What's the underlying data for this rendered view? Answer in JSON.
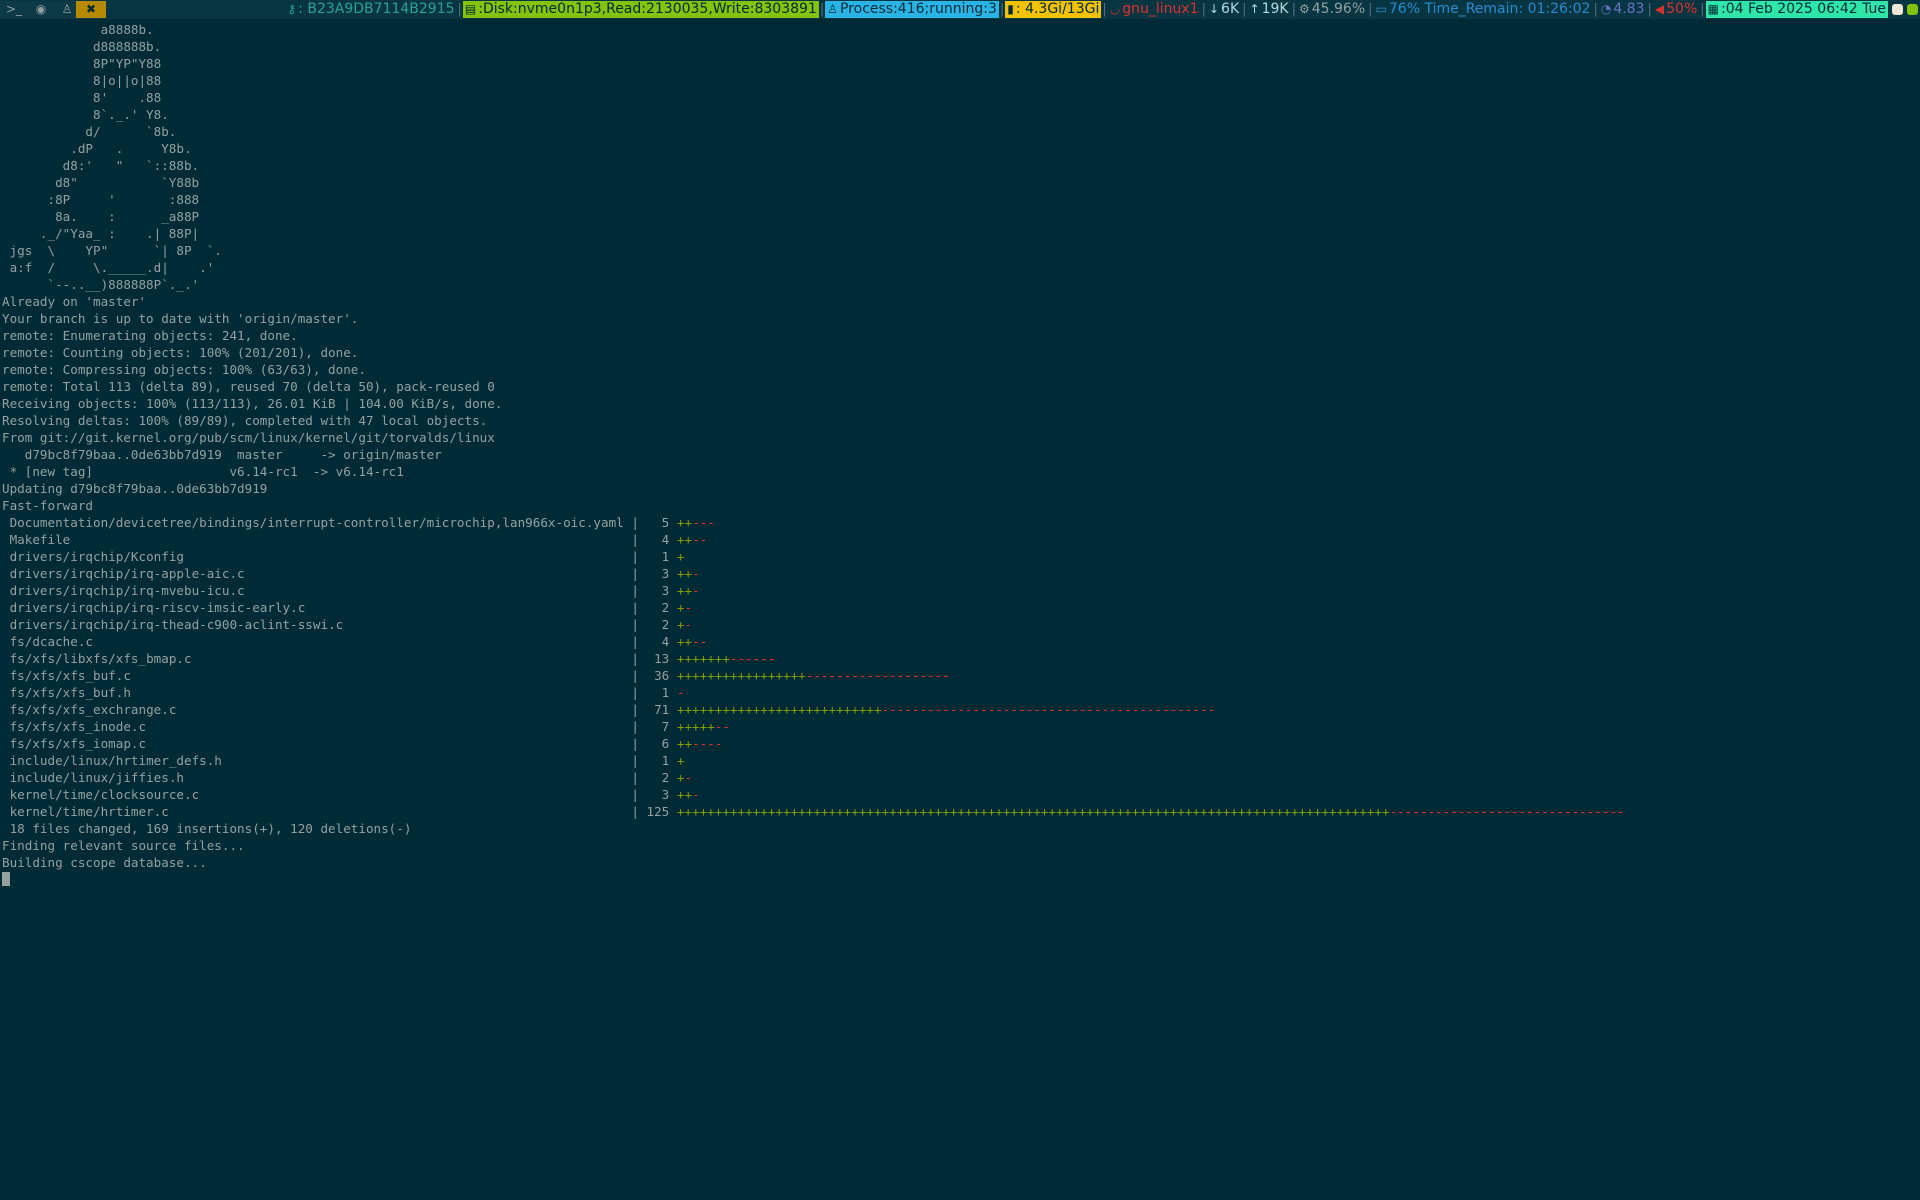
{
  "topbar": {
    "workspaces": [
      {
        "icon": "terminal-icon",
        "glyph": ">_",
        "active": false
      },
      {
        "icon": "firefox-icon",
        "glyph": "◉",
        "active": false
      },
      {
        "icon": "linux-tux-icon",
        "glyph": "♙",
        "active": false
      },
      {
        "icon": "tools-icon",
        "glyph": "✖",
        "active": true
      }
    ],
    "status": {
      "key": {
        "icon": "key-icon",
        "glyph": "⚷",
        "text": ": B23A9DB7114B2915",
        "fg": "#2aa198",
        "bg": "transparent"
      },
      "disk": {
        "icon": "disk-icon",
        "glyph": "▤",
        "text": ":Disk:nvme0n1p3,Read:2130035,Write:8303891",
        "fg": "#002b36",
        "bg": "#85c20a"
      },
      "process": {
        "icon": "linux-icon",
        "glyph": "♙",
        "text": " Process:416;running:3",
        "fg": "#002b36",
        "bg": "#2ab4e6"
      },
      "memory": {
        "icon": "memory-icon",
        "glyph": "▮",
        "text": ": 4.3Gi/13Gi",
        "fg": "#002b36",
        "bg": "#f2c200"
      },
      "network": {
        "icon": "wifi-icon",
        "glyph": "◡",
        "text": " gnu_linux1",
        "fg": "#dc322f",
        "bg": "transparent"
      },
      "download": {
        "icon": "download-icon",
        "glyph": "↓",
        "text": "6K",
        "fg": "#b5d8e0",
        "bg": "transparent"
      },
      "upload": {
        "icon": "upload-icon",
        "glyph": "↑",
        "text": "19K",
        "fg": "#b5d8e0",
        "bg": "transparent"
      },
      "cpu": {
        "icon": "cpu-gear-icon",
        "glyph": "⚙",
        "text": " 45.96%",
        "fg": "#93a1a1",
        "bg": "transparent"
      },
      "battery": {
        "icon": "battery-icon",
        "glyph": "▭",
        "text": " 76% Time_Remain: 01:26:02",
        "fg": "#268bd2",
        "bg": "transparent"
      },
      "load": {
        "icon": "load-gauge-icon",
        "glyph": "◔",
        "text": " 4.83",
        "fg": "#6c71c4",
        "bg": "transparent"
      },
      "volume": {
        "icon": "speaker-icon",
        "glyph": "◀",
        "text": " 50%",
        "fg": "#dc322f",
        "bg": "transparent"
      },
      "date": {
        "icon": "calendar-icon",
        "glyph": "▦",
        "text": ":04 Feb 2025 06:42 Tue",
        "fg": "#002b36",
        "bg": "#2ee6a8"
      }
    },
    "tray": [
      {
        "icon": "tray-app-icon",
        "color": "#eee8d5"
      },
      {
        "icon": "tray-network-icon",
        "color": "#85c20a"
      }
    ]
  },
  "terminal": {
    "ascii_art": [
      "             a8888b.",
      "            d888888b.",
      "            8P\"YP\"Y88",
      "            8|o||o|88",
      "            8'    .88",
      "            8`._.' Y8.",
      "           d/      `8b.",
      "         .dP   .     Y8b.",
      "        d8:'   \"   `::88b.",
      "       d8\"           `Y88b",
      "      :8P     '       :888",
      "       8a.    :      _a88P",
      "     ._/\"Yaa_ :    .| 88P|",
      " jgs  \\    YP\"      `| 8P  `.",
      " a:f  /     \\._____.d|    .'",
      "      `--..__)888888P`._.'"
    ],
    "git_output": [
      "Already on 'master'",
      "Your branch is up to date with 'origin/master'.",
      "remote: Enumerating objects: 241, done.",
      "remote: Counting objects: 100% (201/201), done.",
      "remote: Compressing objects: 100% (63/63), done.",
      "remote: Total 113 (delta 89), reused 70 (delta 50), pack-reused 0",
      "Receiving objects: 100% (113/113), 26.01 KiB | 104.00 KiB/s, done.",
      "Resolving deltas: 100% (89/89), completed with 47 local objects.",
      "From git://git.kernel.org/pub/scm/linux/kernel/git/torvalds/linux",
      "   d79bc8f79baa..0de63bb7d919  master     -> origin/master",
      " * [new tag]                  v6.14-rc1  -> v6.14-rc1",
      "Updating d79bc8f79baa..0de63bb7d919",
      "Fast-forward"
    ],
    "diffstat": [
      {
        "file": "Documentation/devicetree/bindings/interrupt-controller/microchip,lan966x-oic.yaml",
        "count": "5",
        "plus": "++",
        "minus": "---"
      },
      {
        "file": "Makefile",
        "count": "4",
        "plus": "++",
        "minus": "--"
      },
      {
        "file": "drivers/irqchip/Kconfig",
        "count": "1",
        "plus": "+",
        "minus": ""
      },
      {
        "file": "drivers/irqchip/irq-apple-aic.c",
        "count": "3",
        "plus": "++",
        "minus": "-"
      },
      {
        "file": "drivers/irqchip/irq-mvebu-icu.c",
        "count": "3",
        "plus": "++",
        "minus": "-"
      },
      {
        "file": "drivers/irqchip/irq-riscv-imsic-early.c",
        "count": "2",
        "plus": "+",
        "minus": "-"
      },
      {
        "file": "drivers/irqchip/irq-thead-c900-aclint-sswi.c",
        "count": "2",
        "plus": "+",
        "minus": "-"
      },
      {
        "file": "fs/dcache.c",
        "count": "4",
        "plus": "++",
        "minus": "--"
      },
      {
        "file": "fs/xfs/libxfs/xfs_bmap.c",
        "count": "13",
        "plus": "+++++++",
        "minus": "------"
      },
      {
        "file": "fs/xfs/xfs_buf.c",
        "count": "36",
        "plus": "+++++++++++++++++",
        "minus": "-------------------"
      },
      {
        "file": "fs/xfs/xfs_buf.h",
        "count": "1",
        "plus": "",
        "minus": "-"
      },
      {
        "file": "fs/xfs/xfs_exchrange.c",
        "count": "71",
        "plus": "+++++++++++++++++++++++++++",
        "minus": "--------------------------------------------"
      },
      {
        "file": "fs/xfs/xfs_inode.c",
        "count": "7",
        "plus": "+++++",
        "minus": "--"
      },
      {
        "file": "fs/xfs/xfs_iomap.c",
        "count": "6",
        "plus": "++",
        "minus": "----"
      },
      {
        "file": "include/linux/hrtimer_defs.h",
        "count": "1",
        "plus": "+",
        "minus": ""
      },
      {
        "file": "include/linux/jiffies.h",
        "count": "2",
        "plus": "+",
        "minus": "-"
      },
      {
        "file": "kernel/time/clocksource.c",
        "count": "3",
        "plus": "++",
        "minus": "-"
      },
      {
        "file": "kernel/time/hrtimer.c",
        "count": "125",
        "plus": "++++++++++++++++++++++++++++++++++++++++++++++++++++++++++++++++++++++++++++++++++++++++++++++",
        "minus": "-------------------------------"
      }
    ],
    "trailer": [
      " 18 files changed, 169 insertions(+), 120 deletions(-)",
      "Finding relevant source files...",
      "Building cscope database..."
    ]
  }
}
